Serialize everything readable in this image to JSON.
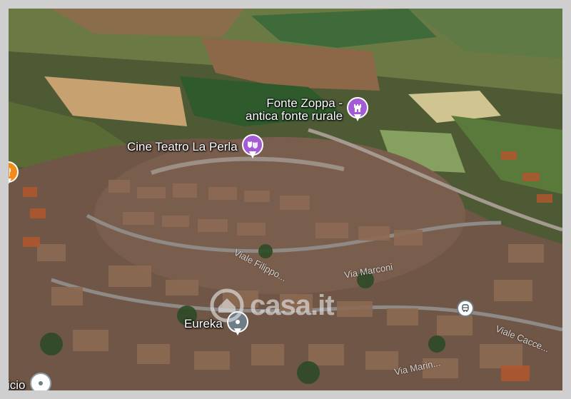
{
  "map": {
    "pois": [
      {
        "id": "fonte-zoppa",
        "label_line1": "Fonte Zoppa -",
        "label_line2": "antica fonte rurale",
        "icon": "castle-icon",
        "color": "#a35bd6"
      },
      {
        "id": "cine-teatro",
        "label": "Cine Teatro La Perla",
        "icon": "theater-masks-icon",
        "color": "#a35bd6"
      },
      {
        "id": "eureka",
        "label": "Eureka",
        "icon": "map-pin-icon",
        "color": "#6f7d86"
      },
      {
        "id": "partial",
        "label": "icio",
        "icon": "map-pin-icon",
        "color": "#8fa0aa"
      },
      {
        "id": "food",
        "label": "",
        "icon": "restaurant-icon",
        "color": "#f08b1e"
      }
    ],
    "streets": [
      {
        "label": "Viale Filippo..."
      },
      {
        "label": "Via Marconi"
      },
      {
        "label": "Viale Cacce..."
      },
      {
        "label": "Via Marin..."
      }
    ],
    "watermark": "casa.it",
    "transit_icon": "bus-icon"
  }
}
